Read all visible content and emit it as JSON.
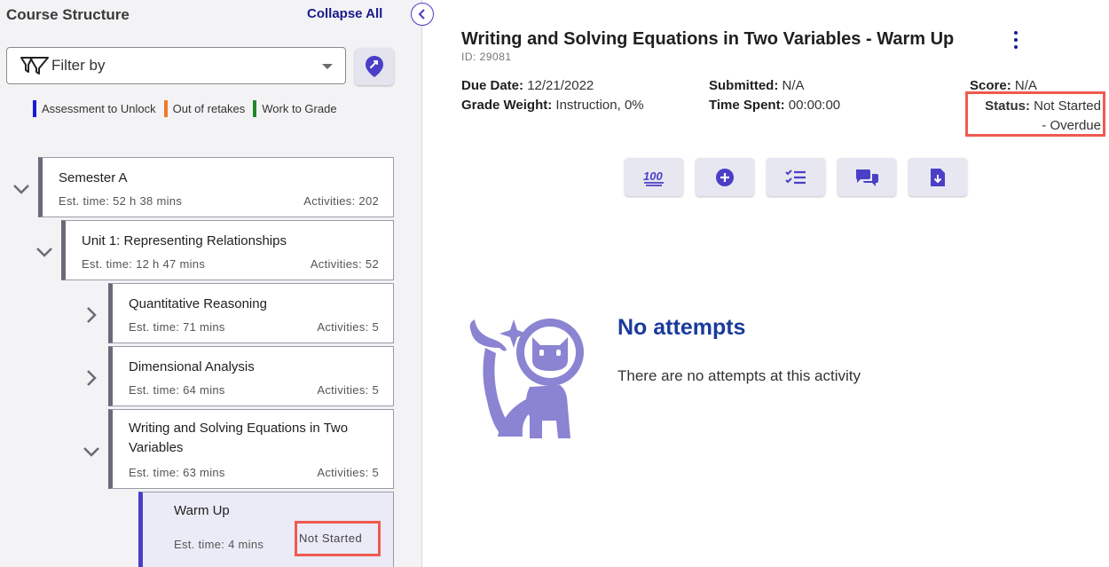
{
  "sidebar": {
    "title": "Course Structure",
    "collapse_label": "Collapse All",
    "filter_placeholder": "Filter by",
    "legend": [
      {
        "label": "Assessment to Unlock",
        "color": "#1a1ad6"
      },
      {
        "label": "Out of retakes",
        "color": "#f07a2a"
      },
      {
        "label": "Work to Grade",
        "color": "#1f8a2a"
      }
    ],
    "tree": {
      "semester": {
        "title": "Semester A",
        "est": "Est. time: 52 h 38 mins",
        "acts": "Activities: 202"
      },
      "unit": {
        "title": "Unit 1: Representing Relationships",
        "est": "Est. time: 12 h 47 mins",
        "acts": "Activities: 52"
      },
      "lesson1": {
        "title": "Quantitative Reasoning",
        "est": "Est. time: 71 mins",
        "acts": "Activities: 5"
      },
      "lesson2": {
        "title": "Dimensional Analysis",
        "est": "Est. time: 64 mins",
        "acts": "Activities: 5"
      },
      "lesson3": {
        "title": "Writing and Solving Equations in Two Variables",
        "est": "Est. time: 63 mins",
        "acts": "Activities: 5"
      },
      "activity": {
        "title": "Warm Up",
        "est": "Est. time: 4 mins",
        "status": "Not Started"
      }
    }
  },
  "main": {
    "title": "Writing and Solving Equations in Two Variables - Warm Up",
    "id": "ID: 29081",
    "due_label": "Due Date:",
    "due_value": "12/21/2022",
    "weight_label": "Grade Weight:",
    "weight_value": "Instruction, 0%",
    "submitted_label": "Submitted:",
    "submitted_value": "N/A",
    "time_label": "Time Spent:",
    "time_value": "00:00:00",
    "score_label": "Score:",
    "score_value": "N/A",
    "status_label": "Status:",
    "status_value_1": "Not Started",
    "status_value_2": "- Overdue",
    "tools": [
      "hundred-points-icon",
      "add-circle-icon",
      "checklist-icon",
      "chat-icon",
      "file-download-icon"
    ],
    "empty": {
      "title": "No attempts",
      "description": "There are no attempts at this activity"
    },
    "accent": "#4a3fc6"
  }
}
